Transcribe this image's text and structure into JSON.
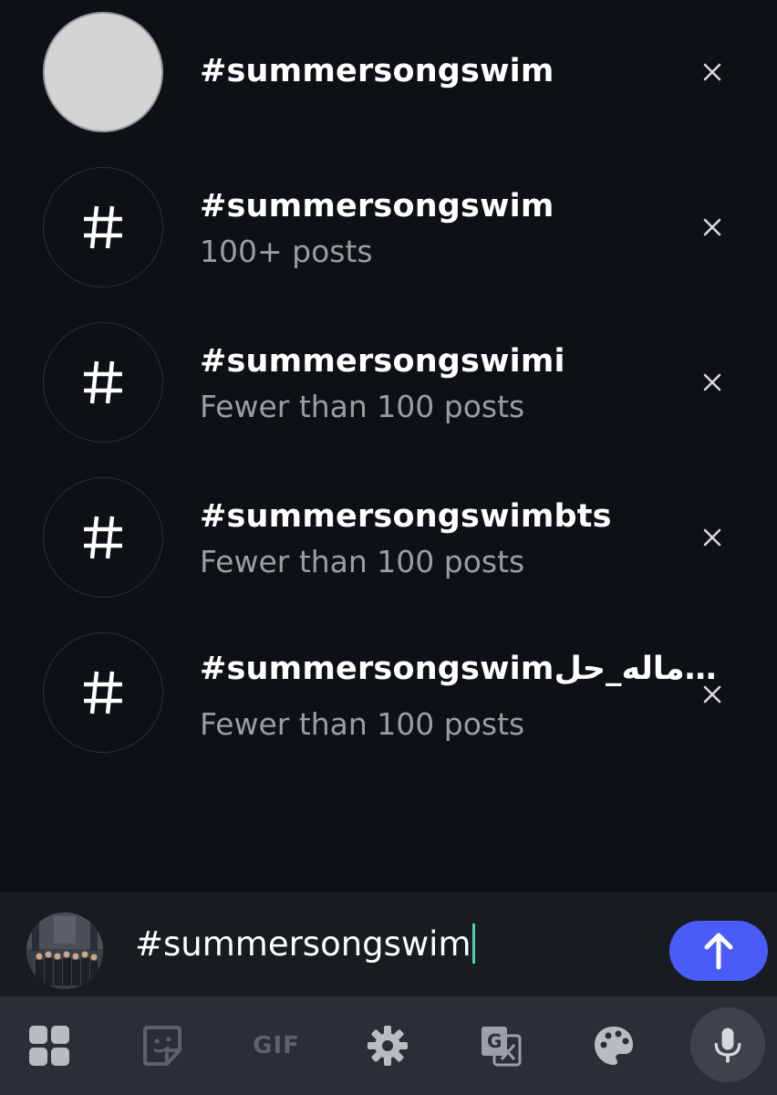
{
  "suggestions": [
    {
      "title": "#summersongswim",
      "subtitle": "",
      "avatar": "gray-circle"
    },
    {
      "title": "#summersongswim",
      "subtitle": "100+ posts",
      "avatar": "hash-icon"
    },
    {
      "title": "#summersongswimi",
      "subtitle": "Fewer than 100 posts",
      "avatar": "hash-icon"
    },
    {
      "title": "#summersongswimbts",
      "subtitle": "Fewer than 100 posts",
      "avatar": "hash-icon"
    },
    {
      "title": "#summersongswimماله_حل…",
      "subtitle": "Fewer than 100 posts",
      "avatar": "hash-icon"
    }
  ],
  "composer": {
    "input_value": "#summersongswim",
    "send_icon": "arrow-up-icon"
  },
  "keyboard_toolbar": {
    "items": [
      "apps-grid-icon",
      "sticker-icon",
      "GIF",
      "gear-icon",
      "translate-icon",
      "palette-icon",
      "mic-icon"
    ]
  },
  "colors": {
    "background": "#0d1014",
    "send_button": "#4a5cf7",
    "caret": "#4fd1b5",
    "subtitle": "#9a9ea4"
  }
}
